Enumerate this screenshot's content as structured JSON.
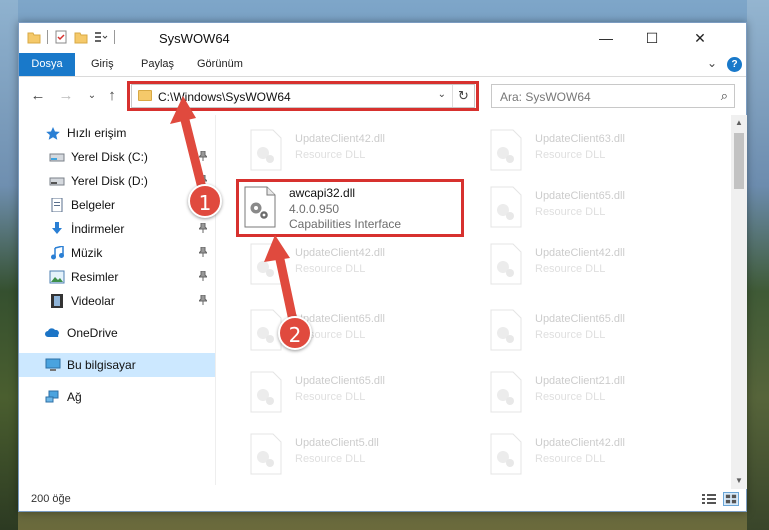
{
  "window": {
    "title": "SysWOW64",
    "minimize": "—",
    "maximize": "☐",
    "close": "✕"
  },
  "ribbon": {
    "tabs": [
      {
        "label": "Dosya"
      },
      {
        "label": "Giriş"
      },
      {
        "label": "Paylaş"
      },
      {
        "label": "Görünüm"
      }
    ],
    "collapse_icon": "⌄",
    "help_icon": "?"
  },
  "nav": {
    "back": "←",
    "forward": "→",
    "recent": "⌄",
    "up": "↑",
    "address": "C:\\Windows\\SysWOW64",
    "address_chevron": "⌄",
    "refresh": "↻",
    "search_placeholder": "Ara: SysWOW64",
    "search_icon": "⌕"
  },
  "sidebar": {
    "items": [
      {
        "label": "Hızlı erişim",
        "icon": "star-icon"
      },
      {
        "label": "Yerel Disk (C:)",
        "icon": "drive-icon",
        "pinned": true
      },
      {
        "label": "Yerel Disk (D:)",
        "icon": "drive-icon",
        "pinned": true
      },
      {
        "label": "Belgeler",
        "icon": "documents-icon",
        "pinned": true
      },
      {
        "label": "İndirmeler",
        "icon": "download-icon",
        "pinned": true
      },
      {
        "label": "Müzik",
        "icon": "music-icon",
        "pinned": true
      },
      {
        "label": "Resimler",
        "icon": "pictures-icon",
        "pinned": true
      },
      {
        "label": "Videolar",
        "icon": "videos-icon",
        "pinned": true
      },
      {
        "label": "OneDrive",
        "icon": "cloud-icon"
      },
      {
        "label": "Bu bilgisayar",
        "icon": "computer-icon",
        "selected": true
      },
      {
        "label": "Ağ",
        "icon": "network-icon"
      }
    ]
  },
  "files": {
    "highlighted": {
      "name": "awcapi32.dll",
      "version": "4.0.0.950",
      "description": "Capabilities Interface"
    },
    "faded": [
      {
        "name": "UpdateClient42.dll",
        "desc": "Resource DLL"
      },
      {
        "name": "UpdateClient63.dll",
        "desc": "Resource DLL"
      },
      {
        "name": "UpdateClient65.dll",
        "desc": "Resource DLL"
      },
      {
        "name": "UpdateClient42.dll",
        "desc": "Resource DLL"
      },
      {
        "name": "UpdateClient42.dll",
        "desc": "Resource DLL"
      },
      {
        "name": "UpdateClient65.dll",
        "desc": "Resource DLL"
      },
      {
        "name": "UpdateClient65.dll",
        "desc": "Resource DLL"
      },
      {
        "name": "UpdateClient65.dll",
        "desc": "Resource DLL"
      },
      {
        "name": "UpdateClient65.dll",
        "desc": "Resource DLL"
      },
      {
        "name": "UpdateClient21.dll",
        "desc": "Resource DLL"
      },
      {
        "name": "UpdateClient5.dll",
        "desc": "Resource DLL"
      },
      {
        "name": "UpdateClient42.dll",
        "desc": "Resource DLL"
      }
    ]
  },
  "status": {
    "count": "200 öğe"
  },
  "annotations": {
    "step1": "1",
    "step2": "2",
    "color": "#d7312e"
  },
  "colors": {
    "accent": "#1979ca",
    "selection": "#cce8ff",
    "highlight": "#d7312e"
  }
}
